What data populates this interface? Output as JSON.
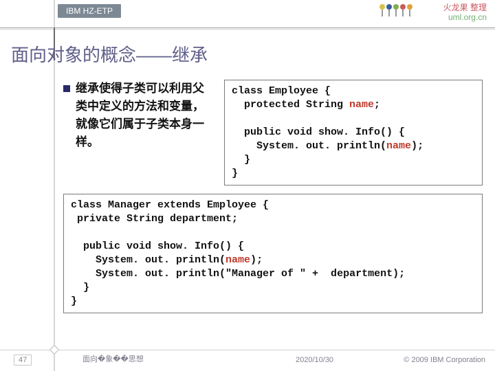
{
  "header": {
    "tab": "IBM HZ-ETP",
    "watermark_line1": "火龙果  整理",
    "watermark_line2": "uml.org.cn",
    "icon_colors": [
      "#d6c24a",
      "#3a5fa0",
      "#7fae4c",
      "#c75a5a",
      "#e2a23a"
    ]
  },
  "title": "面向对象的概念——继承",
  "bullet": {
    "text": "继承使得子类可以利用父类中定义的方法和变量，就像它们属于子类本身一样。"
  },
  "code1": {
    "l1": "class Employee {",
    "l2": "  protected String ",
    "l2_hl": "name",
    "l2_end": ";",
    "l3": "  public void show. Info() {",
    "l4_a": "    System. out. println(",
    "l4_hl": "name",
    "l4_b": ");",
    "l5": "  }",
    "l6": "}"
  },
  "code2": {
    "l1": "class Manager extends Employee {",
    "l2": " private String department;",
    "l3": "  public void show. Info() {",
    "l4_a": "    System. out. println(",
    "l4_hl": "name",
    "l4_b": ");",
    "l5": "    System. out. println(\"Manager of \" +  department);",
    "l6": "  }",
    "l7": "}"
  },
  "footer": {
    "page": "47",
    "center": "面向�象��思想",
    "date": "2020/10/30",
    "copyright": "© 2009 IBM Corporation"
  }
}
